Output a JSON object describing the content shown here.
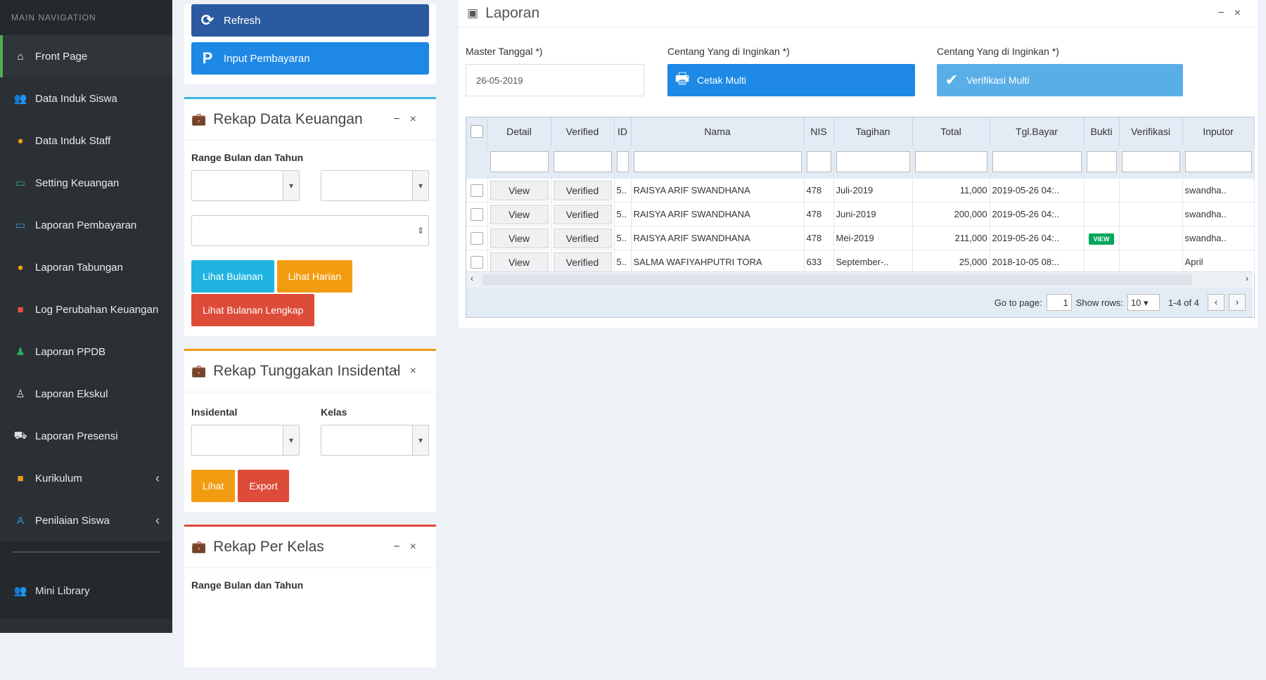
{
  "sidebar": {
    "heading": "MAIN NAVIGATION",
    "items": [
      {
        "label": "Front Page",
        "icon": "home-icon",
        "glyph": "⌂",
        "color": "#ffffff"
      },
      {
        "label": "Data Induk Siswa",
        "icon": "users-icon",
        "glyph": "👥",
        "color": "#e74c3c"
      },
      {
        "label": "Data Induk Staff",
        "icon": "user-group-icon",
        "glyph": "●",
        "color": "#f39c12"
      },
      {
        "label": "Setting Keuangan",
        "icon": "money-icon",
        "glyph": "▭",
        "color": "#27ae60"
      },
      {
        "label": "Laporan Pembayaran",
        "icon": "card-icon",
        "glyph": "▭",
        "color": "#3498db"
      },
      {
        "label": "Laporan Tabungan",
        "icon": "coin-icon",
        "glyph": "●",
        "color": "#f39c12"
      },
      {
        "label": "Log Perubahan Keuangan",
        "icon": "list-icon",
        "glyph": "■",
        "color": "#e74c3c"
      },
      {
        "label": "Laporan PPDB",
        "icon": "person-icon",
        "glyph": "♟",
        "color": "#27ae60"
      },
      {
        "label": "Laporan Ekskul",
        "icon": "person-outline-icon",
        "glyph": "♙",
        "color": "#dddddd"
      },
      {
        "label": "Laporan Presensi",
        "icon": "car-icon",
        "glyph": "⛟",
        "color": "#dddddd"
      },
      {
        "label": "Kurikulum",
        "icon": "briefcase-icon",
        "glyph": "■",
        "color": "#f39c12",
        "chevron": "‹"
      },
      {
        "label": "Penilaian Siswa",
        "icon": "font-icon",
        "glyph": "A",
        "color": "#3498db",
        "chevron": "‹"
      }
    ],
    "bottom": {
      "label": "Mini Library",
      "icon": "users-icon",
      "glyph": "👥"
    }
  },
  "actions": {
    "refresh": {
      "label": "Refresh",
      "glyph": "⟳",
      "color": "#2c5aa0"
    },
    "input": {
      "label": "Input Pembayaran",
      "glyph": "P",
      "color": "#1e88e5"
    }
  },
  "rekap_keuangan": {
    "title": "Rekap Data Keuangan",
    "range_label": "Range Bulan dan Tahun",
    "btn_bulanan": "Lihat Bulanan",
    "btn_harian": "Lihat Harian",
    "btn_lengkap": "Lihat Bulanan Lengkap"
  },
  "rekap_tunggakan": {
    "title": "Rekap Tunggakan Insidental",
    "insidental_label": "Insidental",
    "kelas_label": "Kelas",
    "btn_lihat": "Lihat",
    "btn_export": "Export"
  },
  "rekap_kelas": {
    "title": "Rekap Per Kelas",
    "range_label": "Range Bulan dan Tahun"
  },
  "laporan": {
    "title": "Laporan",
    "master_label": "Master Tanggal *)",
    "master_value": "26-05-2019",
    "centang1_label": "Centang Yang di Inginkan *)",
    "cetak_label": "Cetak Multi",
    "centang2_label": "Centang Yang di Inginkan *)",
    "verif_label": "Verifikasi Multi"
  },
  "grid": {
    "columns": [
      "Detail",
      "Verified",
      "ID",
      "Nama",
      "NIS",
      "Tagihan",
      "Total",
      "Tgl.Bayar",
      "Bukti",
      "Verifikasi",
      "Inputor"
    ],
    "rows": [
      {
        "detail": "View",
        "verified": "Verified",
        "id": "5..",
        "nama": "RAISYA ARIF SWANDHANA",
        "nis": "478",
        "tagihan": "Juli-2019",
        "total": "11,000",
        "tgl": "2019-05-26 04:..",
        "bukti": "",
        "verifikasi": "",
        "inputor": "swandha.."
      },
      {
        "detail": "View",
        "verified": "Verified",
        "id": "5..",
        "nama": "RAISYA ARIF SWANDHANA",
        "nis": "478",
        "tagihan": "Juni-2019",
        "total": "200,000",
        "tgl": "2019-05-26 04:..",
        "bukti": "",
        "verifikasi": "",
        "inputor": "swandha.."
      },
      {
        "detail": "View",
        "verified": "Verified",
        "id": "5..",
        "nama": "RAISYA ARIF SWANDHANA",
        "nis": "478",
        "tagihan": "Mei-2019",
        "total": "211,000",
        "tgl": "2019-05-26 04:..",
        "bukti": "VIEW",
        "verifikasi": "",
        "inputor": "swandha.."
      },
      {
        "detail": "View",
        "verified": "Verified",
        "id": "5..",
        "nama": "SALMA WAFIYAHPUTRI TORA",
        "nis": "633",
        "tagihan": "September-..",
        "total": "25,000",
        "tgl": "2018-10-05 08:..",
        "bukti": "",
        "verifikasi": "",
        "inputor": "April"
      }
    ],
    "pager": {
      "goto_label": "Go to page:",
      "page": "1",
      "show_label": "Show rows:",
      "rows_value": "10",
      "range_text": "1-4 of 4"
    }
  }
}
